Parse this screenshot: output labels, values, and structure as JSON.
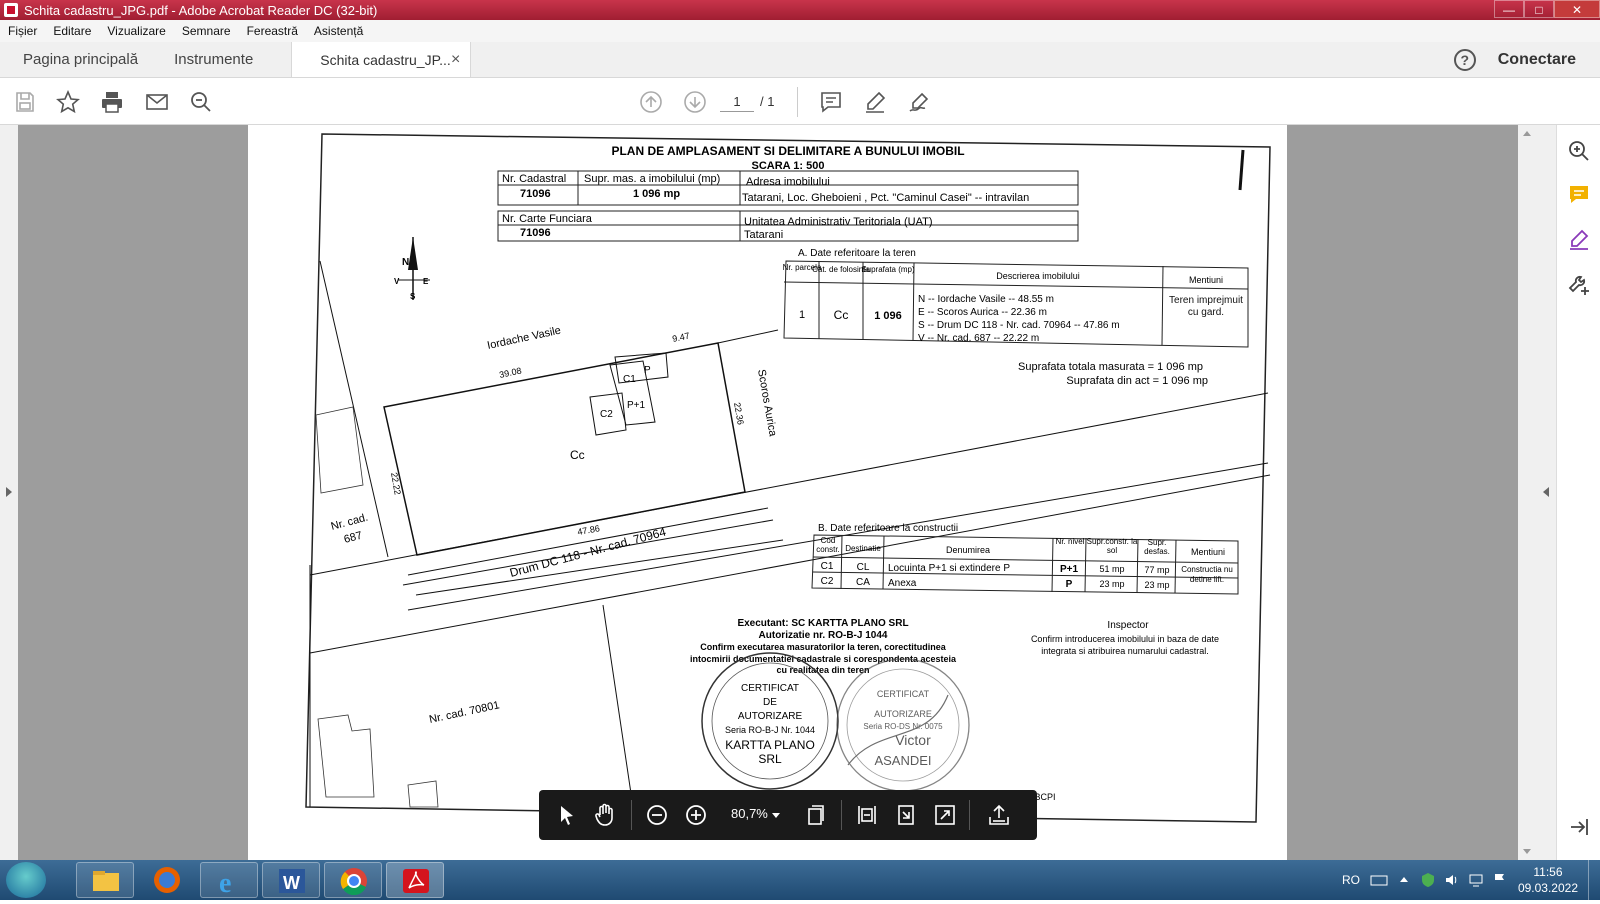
{
  "window": {
    "title": "Schita cadastru_JPG.pdf - Adobe Acrobat Reader DC (32-bit)",
    "minimize": "—",
    "maximize": "□",
    "close": "✕"
  },
  "menu": [
    "Fișier",
    "Editare",
    "Vizualizare",
    "Semnare",
    "Fereastră",
    "Asistență"
  ],
  "tabs": {
    "home": "Pagina principală",
    "tools": "Instrumente",
    "document": "Schita cadastru_JP...",
    "close": "×",
    "help": "?",
    "connect": "Conectare"
  },
  "toolbar": {
    "page_current": "1",
    "page_total": "/ 1"
  },
  "floating_toolbar": {
    "zoom": "80,7%"
  },
  "document": {
    "title": "PLAN DE AMPLASAMENT SI DELIMITARE A BUNULUI IMOBIL",
    "scale": "SCARA 1: 500",
    "table1": {
      "h_nr_cadastral": "Nr. Cadastral",
      "h_suprafata": "Supr. mas. a imobilului (mp)",
      "h_adresa": "Adresa imobilului",
      "nr_cadastral": "71096",
      "suprafata": "1 096 mp",
      "adresa": "Tatarani, Loc. Gheboieni , Pct. \"Caminul Casei\" -- intravilan"
    },
    "table2": {
      "h_carte": "Nr. Carte Funciara",
      "h_uat": "Unitatea Administrativ Teritoriala (UAT)",
      "carte": "71096",
      "uat": "Tatarani"
    },
    "sectionA": {
      "title": "A. Date referitoare la teren",
      "h_parcela": "Nr. parcela",
      "h_cat": "Cat. de folosinta",
      "h_supr": "Suprafata (mp)",
      "h_desc": "Descrierea imobilului",
      "h_mentiuni": "Mentiuni",
      "parcela": "1",
      "cat": "Cc",
      "supr": "1 096",
      "desc_n": "N -- Iordache Vasile --  48.55 m",
      "desc_e": "E -- Scoros Aurica  -- 22.36 m",
      "desc_s": "S -- Drum  DC 118 - Nr. cad. 70964 -- 47.86 m",
      "desc_v": "V -- Nr. cad. 687 -- 22.22 m",
      "mentiuni": "Teren imprejmuit cu gard."
    },
    "totals": {
      "masurata": "Suprafata totala masurata = 1 096 mp",
      "act": "Suprafata din act = 1 096 mp"
    },
    "sectionB": {
      "title": "B. Date referitoare la constructii",
      "headers": [
        "Cod constr.",
        "Destinatie",
        "Denumirea",
        "Nr. nivel",
        "Supr.constr. la sol",
        "Supr. desfas.",
        "Mentiuni"
      ],
      "rows": [
        [
          "C1",
          "CL",
          "Locuinta P+1 si extindere P",
          "P+1",
          "51 mp",
          "77 mp"
        ],
        [
          "C2",
          "CA",
          "Anexa",
          "P",
          "23 mp",
          "23 mp"
        ]
      ],
      "mentiuni": "Constructia nu detine lift."
    },
    "executant": {
      "line1": "Executant:  SC KARTTA PLANO SRL",
      "line2": "Autorizatie nr. RO-B-J 1044",
      "line3": "Confirm executarea masuratorilor la teren, corectitudinea",
      "line4": "intocmirii documentatiei cadastrale si corespondenta acesteia",
      "line5": "cu realitatea din teren"
    },
    "inspector": {
      "title": "Inspector",
      "line1": "Confirm introducerea imobilului in baza de date",
      "line2": "integrata si atribuirea numarului cadastral.",
      "footer": "bila BCPI"
    },
    "stamp1": [
      "CERTIFICAT",
      "DE",
      "AUTORIZARE",
      "Seria RO-B-J Nr. 1044",
      "KARTTA PLANO",
      "SRL"
    ],
    "stamp2": [
      "CERTIFICAT",
      "AUTORIZARE",
      "Seria RO-DS Nr. 0075",
      "Victor",
      "ASANDEI"
    ],
    "map": {
      "north": "N",
      "east": "E",
      "south": "S",
      "west": "V",
      "neighbor_n": "Iordache Vasile",
      "neighbor_e": "Scoros Aurica",
      "neighbor_w": "Nr. cad.",
      "neighbor_w2": "687",
      "road": "Drum  DC 118 - Nr. cad. 70964",
      "neighbor_s": "Nr. cad. 70801",
      "parcel_use": "Cc",
      "dim_top_left": "39.08",
      "dim_top_right": "9.47",
      "dim_right": "22.36",
      "dim_bottom": "47.86",
      "dim_left": "22.22",
      "c1": "C1",
      "p": "P",
      "c2": "C2",
      "p1": "P+1"
    }
  },
  "taskbar": {
    "lang": "RO",
    "time": "11:56",
    "date": "09.03.2022"
  }
}
